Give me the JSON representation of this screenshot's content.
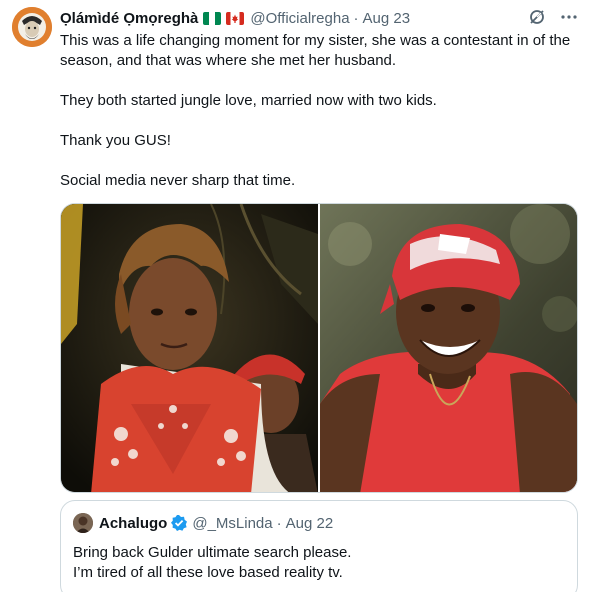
{
  "tweet": {
    "author": {
      "display_name": "Ọlámìdé Ọmọreghà",
      "flags": [
        "nigeria-flag",
        "canada-flag"
      ],
      "handle": "@Officialregha",
      "date": "Aug 23"
    },
    "separator": "·",
    "paragraphs": [
      "This was a life changing moment for my sister, she was a contestant in of the season, and that was where she met her husband.",
      "They both started jungle love, married now with two kids.",
      "Thank you GUS!",
      "Social media never sharp that time."
    ],
    "actions": {
      "grok_icon": "grok-icon",
      "more_icon": "more-icon"
    },
    "media": [
      {
        "name": "photo-woman-red-scarf"
      },
      {
        "name": "photo-man-red-cap"
      }
    ]
  },
  "quote": {
    "author": {
      "display_name": "Achalugo",
      "verified": true,
      "handle": "@_MsLinda",
      "date": "Aug 22"
    },
    "separator": "·",
    "text_lines": [
      "Bring back Gulder ultimate search please.",
      "I’m tired of all these love based reality tv."
    ]
  },
  "colors": {
    "text": "#0f1419",
    "secondary": "#536471",
    "border": "#cfd9de",
    "verified": "#1d9bf0"
  }
}
